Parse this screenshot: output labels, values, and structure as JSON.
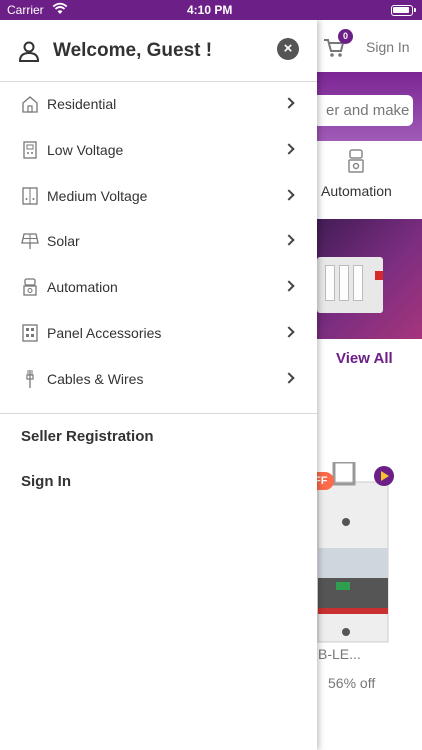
{
  "status_bar": {
    "carrier": "Carrier",
    "time": "4:10 PM"
  },
  "background": {
    "cart_count": "0",
    "sign_in": "Sign In",
    "search_placeholder": "er and make",
    "category_label": "Automation",
    "view_all": "View All",
    "offer_tag": "FF",
    "product_name": "B-LE...",
    "discount": "56% off"
  },
  "drawer": {
    "welcome": "Welcome, Guest !",
    "menu": [
      {
        "label": "Residential",
        "icon": "house-icon"
      },
      {
        "label": "Low Voltage",
        "icon": "low-voltage-icon"
      },
      {
        "label": "Medium Voltage",
        "icon": "medium-voltage-icon"
      },
      {
        "label": "Solar",
        "icon": "solar-panel-icon"
      },
      {
        "label": "Automation",
        "icon": "automation-icon"
      },
      {
        "label": "Panel Accessories",
        "icon": "panel-accessories-icon"
      },
      {
        "label": "Cables & Wires",
        "icon": "cable-icon"
      }
    ],
    "links": {
      "seller_registration": "Seller Registration",
      "sign_in": "Sign In"
    }
  },
  "colors": {
    "brand": "#6c1f86",
    "offer": "#ff6b4a"
  }
}
